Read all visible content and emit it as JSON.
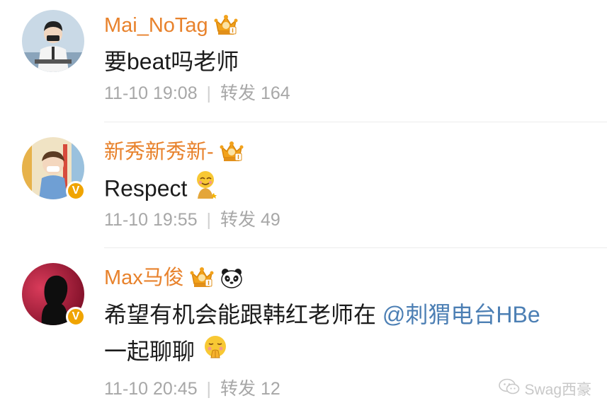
{
  "comments": [
    {
      "username": "Mai_NoTag",
      "text": "要beat吗老师",
      "time": "11-10 19:08",
      "repost_label": "转发",
      "repost_count": "164"
    },
    {
      "username": "新秀新秀新-",
      "text": "Respect",
      "time": "11-10 19:55",
      "repost_label": "转发",
      "repost_count": "49"
    },
    {
      "username": "Max马俊",
      "text_line1": "希望有机会能跟韩红老师在 ",
      "mention": "@刺猬电台HBe",
      "text_line2": "一起聊聊",
      "time": "11-10 20:45",
      "repost_label": "转发",
      "repost_count": "12"
    }
  ],
  "verified_badge": "V",
  "separator": "|",
  "watermark": "Swag西豪",
  "colors": {
    "username": "#e8822c",
    "mention": "#4c7fb4",
    "meta": "#a7a7a7",
    "verified": "#f0a400"
  },
  "icons": [
    "vip-crown-icon",
    "panda-icon",
    "verified-badge-icon",
    "blush-emoji-icon",
    "pleading-emoji-icon",
    "wechat-icon"
  ]
}
